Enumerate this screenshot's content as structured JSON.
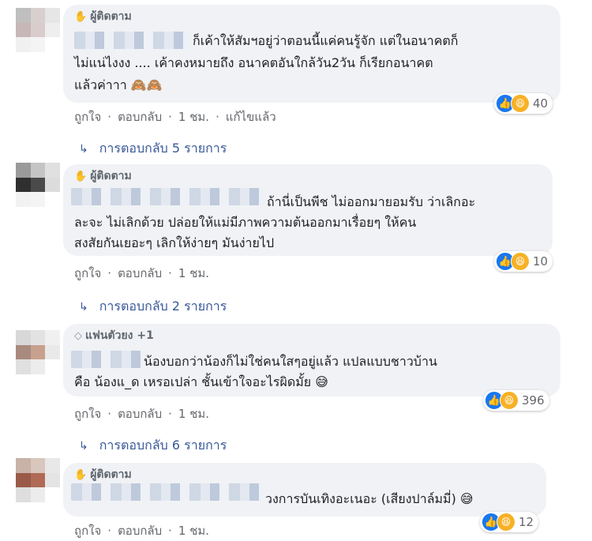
{
  "comments": [
    {
      "badge": "ผู้ติดตาม",
      "text_lines": [
        "ก็เค้าให้สัมฯอยู่ว่าตอนนี้แค่คนรู้จัก แต่ในอนาคตก็",
        "ไม่แน่ไงงง .... เค้าคงหมายถึง อนาคตอันใกล้วัน2วัน ก็เรียกอนาคต",
        "แล้วค่าาา 🙈🙈"
      ],
      "reaction_count": "40",
      "actions": {
        "like": "ถูกใจ",
        "reply": "ตอบกลับ",
        "time": "1 ชม.",
        "edited": "แก้ไขแล้ว"
      },
      "replies_label": "การตอบกลับ 5 รายการ"
    },
    {
      "badge": "ผู้ติดตาม",
      "text_lines": [
        "ถ้านี่เป็นพีช ไม่ออกมายอมรับ ว่าเลิกอะ",
        "ละจะ ไม่เลิกด้วย ปล่อยให้แม่มีภาพความต้นออกมาเรื่อยๆ ให้คน",
        "สงสัยกันเยอะๆ เลิกให้ง่ายๆ มันง่ายไป"
      ],
      "reaction_count": "10",
      "actions": {
        "like": "ถูกใจ",
        "reply": "ตอบกลับ",
        "time": "1 ชม."
      },
      "replies_label": "การตอบกลับ 2 รายการ"
    },
    {
      "badge": "แฟนตัวยง +1",
      "text_lines": [
        "น้องบอกว่าน้องก็ไม่ใช่คนใสๆอยู่แล้ว แปลแบบชาวบ้าน",
        "คือ น้องแ_ด เหรอเปล่า ชั้นเข้าใจอะไรผิดมั้ย 😅"
      ],
      "reaction_count": "396",
      "actions": {
        "like": "ถูกใจ",
        "reply": "ตอบกลับ",
        "time": "1 ชม."
      },
      "replies_label": "การตอบกลับ 6 รายการ"
    },
    {
      "badge": "ผู้ติดตาม",
      "text_lines": [
        "วงการบันเทิงอะเนอะ (เสียงปาล์มมี่) 😅"
      ],
      "reaction_count": "12",
      "actions": {
        "like": "ถูกใจ",
        "reply": "ตอบกลับ",
        "time": "1 ชม."
      }
    }
  ],
  "icons": {
    "badge": "hand-wave-icon",
    "fan_badge": "diamond-icon",
    "like": "like-icon",
    "haha": "haha-icon",
    "reply_arrow": "reply-arrow-icon"
  },
  "colors": {
    "bubble_bg": "#f0f2f5",
    "link": "#385898",
    "meta": "#65676b",
    "like_blue": "#1877f2",
    "haha_yellow": "#f7b125"
  }
}
